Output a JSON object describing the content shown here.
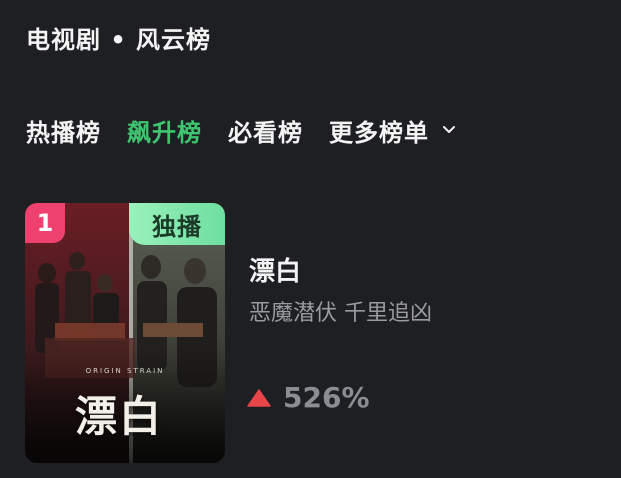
{
  "header": {
    "title": "电视剧 • 风云榜"
  },
  "tabs": [
    {
      "label": "热播榜",
      "active": false
    },
    {
      "label": "飙升榜",
      "active": true
    },
    {
      "label": "必看榜",
      "active": false
    },
    {
      "label": "更多榜单",
      "active": false,
      "icon": "chevron-down-icon"
    }
  ],
  "ranking": [
    {
      "rank": "1",
      "badge": "独播",
      "poster_title": "漂白",
      "poster_subtitle": "ORIGIN STRAIN",
      "title": "漂白",
      "tagline": "恶魔潜伏 千里追凶",
      "trend_icon": "up-triangle-icon",
      "trend_value": "526%"
    }
  ],
  "colors": {
    "background": "#1e1f22",
    "accent_active_tab": "#3ec56f",
    "rank_badge": "#ee4170",
    "exclusive_tag": "#8be9b0",
    "trend_up": "#e8454b",
    "secondary_text": "#9a9ba0"
  }
}
